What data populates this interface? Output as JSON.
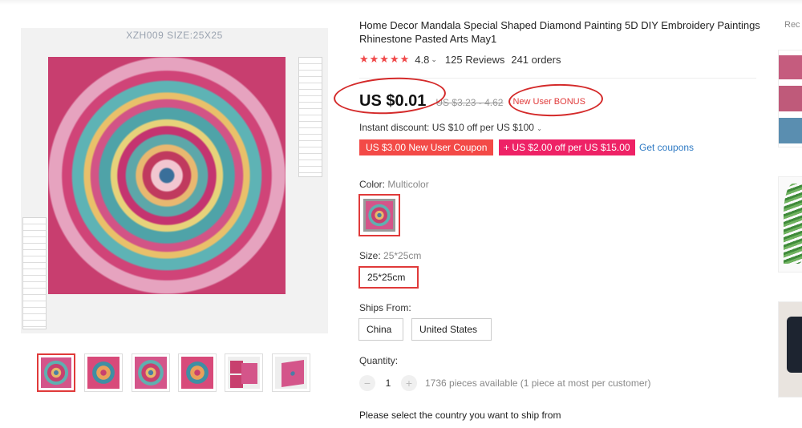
{
  "gallery": {
    "main_caption": "XZH009  SIZE:25X25",
    "thumbnails": [
      {
        "kind": "mandala",
        "active": true
      },
      {
        "kind": "mandala-variant",
        "active": false
      },
      {
        "kind": "mandala",
        "active": false
      },
      {
        "kind": "mandala-variant",
        "active": false
      },
      {
        "kind": "cards",
        "active": false
      },
      {
        "kind": "boxed",
        "active": false
      }
    ]
  },
  "product": {
    "title": "Home Decor Mandala Special Shaped Diamond Painting 5D DIY Embroidery Paintings Rhinestone Pasted Arts May1",
    "rating": {
      "stars": "★★★★★",
      "value": "4.8",
      "caret": "⌄",
      "reviews": "125 Reviews",
      "orders": "241 orders"
    },
    "price": "US $0.01",
    "original_price": "US $3.23 - 4.62",
    "bonus_label": "New User BONUS",
    "instant_discount": "Instant discount: US $10 off per US $100",
    "instant_caret": "⌄",
    "coupons": [
      {
        "label": "US $3.00 New User Coupon",
        "color": "#f34a47"
      },
      {
        "label": "+ US $2.00 off per US $15.00",
        "color": "#ee2266"
      }
    ],
    "get_coupons": "Get coupons",
    "color": {
      "label": "Color:",
      "value": "Multicolor"
    },
    "size": {
      "label": "Size:",
      "value": "25*25cm",
      "options": [
        "25*25cm"
      ]
    },
    "ships_from": {
      "label": "Ships From:",
      "options": [
        "China",
        "United States"
      ]
    },
    "quantity": {
      "label": "Quantity:",
      "minus": "−",
      "value": "1",
      "plus": "+",
      "available": "1736 pieces available (1 piece at most per customer)"
    },
    "ship_note": "Please select the country you want to ship from"
  },
  "recommended": {
    "title": "Rec"
  },
  "colors": {
    "accent": "#e03a3a",
    "link": "#2e7ac4",
    "coupon_pink": "#ee2266",
    "star": "#f0494a"
  }
}
